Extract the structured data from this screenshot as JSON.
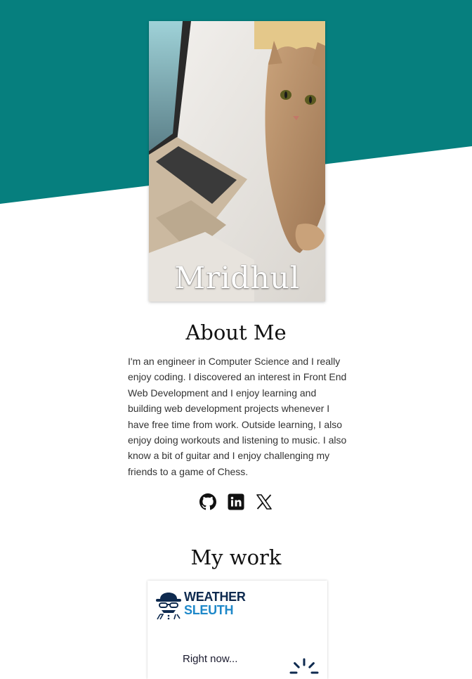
{
  "hero": {
    "name": "Mridhul"
  },
  "about": {
    "title": "About Me",
    "text": "I'm an engineer in Computer Science and I really enjoy coding. I discovered an interest in Front End Web Development and I enjoy learning and building web development projects whenever I have free time from work. Outside learning, I also enjoy doing workouts and listening to music. I also know a bit of guitar and I enjoy challenging my friends to a game of Chess."
  },
  "socials": [
    {
      "icon": "github-icon"
    },
    {
      "icon": "linkedin-icon"
    },
    {
      "icon": "x-icon"
    }
  ],
  "work": {
    "title": "My work",
    "card": {
      "logo_line1": "WEATHER",
      "logo_line2": "SLEUTH",
      "status": "Right now..."
    }
  },
  "colors": {
    "teal": "#067f7e",
    "logo_navy": "#0e2a4f",
    "logo_blue": "#1e88c9"
  }
}
